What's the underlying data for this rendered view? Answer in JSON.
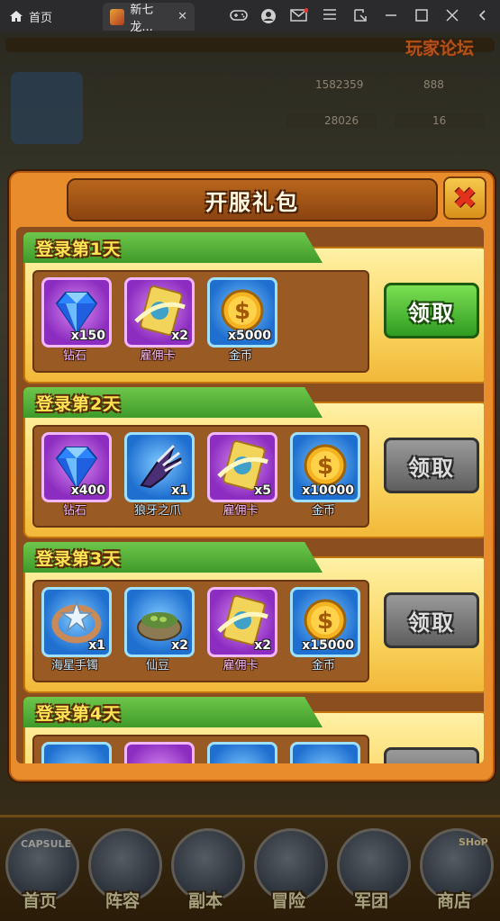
{
  "browser": {
    "home_tab": "首页",
    "game_tab": "新七龙...",
    "close_tab": "✕"
  },
  "game_bg": {
    "forum_label": "玩家论坛",
    "stats": [
      "1582359",
      "888",
      "28026",
      "16"
    ]
  },
  "modal": {
    "title": "开服礼包",
    "close_label": "✖",
    "days": [
      {
        "label": "登录第1天",
        "claim": "领取",
        "claimable": true,
        "items": [
          {
            "name": "钻石",
            "count": "x150",
            "rarity": "purple",
            "icon": "diamond-icon",
            "name_color": "#f2b8ff"
          },
          {
            "name": "雇佣卡",
            "count": "x2",
            "rarity": "purple",
            "icon": "hire-card-icon",
            "name_color": "#f2b8ff"
          },
          {
            "name": "金币",
            "count": "x5000",
            "rarity": "blue",
            "icon": "gold-coin-icon",
            "name_color": "#bfe6ff"
          }
        ]
      },
      {
        "label": "登录第2天",
        "claim": "领取",
        "claimable": false,
        "items": [
          {
            "name": "钻石",
            "count": "x400",
            "rarity": "purple",
            "icon": "diamond-icon",
            "name_color": "#f2b8ff"
          },
          {
            "name": "狼牙之爪",
            "count": "x1",
            "rarity": "blue",
            "icon": "wolf-claw-icon",
            "name_color": "#bfe6ff"
          },
          {
            "name": "雇佣卡",
            "count": "x5",
            "rarity": "purple",
            "icon": "hire-card-icon",
            "name_color": "#f2b8ff"
          },
          {
            "name": "金币",
            "count": "x10000",
            "rarity": "blue",
            "icon": "gold-coin-icon",
            "name_color": "#bfe6ff"
          }
        ]
      },
      {
        "label": "登录第3天",
        "claim": "领取",
        "claimable": false,
        "items": [
          {
            "name": "海星手镯",
            "count": "x1",
            "rarity": "blue",
            "icon": "starfish-bracelet-icon",
            "name_color": "#bfe6ff"
          },
          {
            "name": "仙豆",
            "count": "x2",
            "rarity": "blue",
            "icon": "senzu-bean-icon",
            "name_color": "#bfe6ff"
          },
          {
            "name": "雇佣卡",
            "count": "x2",
            "rarity": "purple",
            "icon": "hire-card-icon",
            "name_color": "#f2b8ff"
          },
          {
            "name": "金币",
            "count": "x15000",
            "rarity": "blue",
            "icon": "gold-coin-icon",
            "name_color": "#bfe6ff"
          }
        ]
      },
      {
        "label": "登录第4天",
        "claim": "",
        "claimable": false,
        "items": []
      }
    ]
  },
  "bottom_nav": [
    {
      "label": "首页",
      "icon": "capsule-icon"
    },
    {
      "label": "阵容",
      "icon": "lineup-icon"
    },
    {
      "label": "副本",
      "icon": "dungeon-icon"
    },
    {
      "label": "冒险",
      "icon": "adventure-icon"
    },
    {
      "label": "军团",
      "icon": "legion-icon"
    },
    {
      "label": "商店",
      "icon": "shop-icon"
    }
  ],
  "bottom_nav_extra": {
    "capsule": "CAPSULE",
    "shop": "SHoP"
  }
}
